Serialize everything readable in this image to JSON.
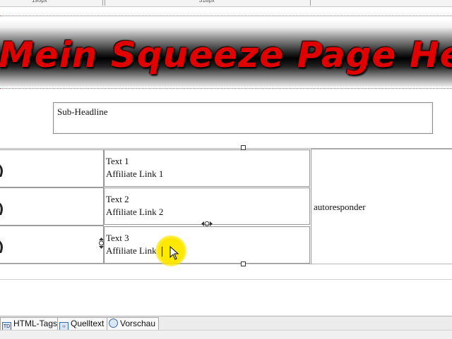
{
  "ruler": {
    "left_label": "195px",
    "right_label": "318px"
  },
  "header": {
    "title": "Mein Squeeze Page Header"
  },
  "subheadline": {
    "text": "Sub-Headline"
  },
  "rows": [
    {
      "text": "Text 1",
      "link": "Affiliate Link 1"
    },
    {
      "text": "Text 2",
      "link": "Affiliate Link 2"
    },
    {
      "text": "Text 3",
      "link": "Affiliate Link 3"
    }
  ],
  "side": {
    "autoresponder": "autoresponder"
  },
  "tabs": [
    {
      "label": "HTML-Tags",
      "icon": "tag-icon"
    },
    {
      "label": "Quelltext",
      "icon": "code-icon"
    },
    {
      "label": "Vorschau",
      "icon": "magnifier-icon"
    }
  ],
  "colors": {
    "header_text": "#e00000",
    "highlight": "#ffe600"
  }
}
